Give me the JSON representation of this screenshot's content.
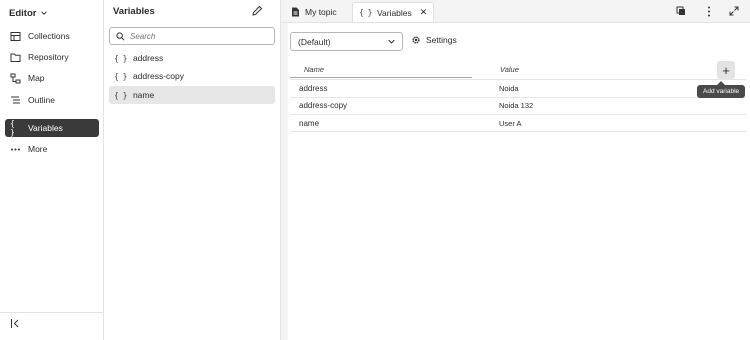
{
  "leftnav": {
    "header": "Editor",
    "items": [
      {
        "label": "Collections",
        "icon": "collections-icon"
      },
      {
        "label": "Repository",
        "icon": "repository-icon"
      },
      {
        "label": "Map",
        "icon": "map-icon"
      },
      {
        "label": "Outline",
        "icon": "outline-icon"
      },
      {
        "label": "Variables",
        "icon": "variables-icon",
        "active": true
      },
      {
        "label": "More",
        "icon": "more-icon"
      }
    ]
  },
  "varpanel": {
    "title": "Variables",
    "search_placeholder": "Search",
    "items": [
      "address",
      "address-copy",
      "name"
    ],
    "selected": "name"
  },
  "tabs": [
    {
      "label": "My topic",
      "icon": "document-icon"
    },
    {
      "label": "Variables",
      "icon": "braces-icon",
      "active": true,
      "closable": true
    }
  ],
  "toolbar": {
    "select_value": "(Default)",
    "settings_label": "Settings"
  },
  "table": {
    "columns": [
      "Name",
      "Value"
    ],
    "rows": [
      {
        "name": "address",
        "value": "Noida"
      },
      {
        "name": "address-copy",
        "value": "Noida 132"
      },
      {
        "name": "name",
        "value": "User A"
      }
    ],
    "add_tooltip": "Add variable"
  },
  "colors": {
    "active_nav_bg": "#3a3a3a",
    "selected_item_bg": "#e6e6e6",
    "editor_bg": "#f4f4f4",
    "tooltip_bg": "#4a4a4a"
  }
}
